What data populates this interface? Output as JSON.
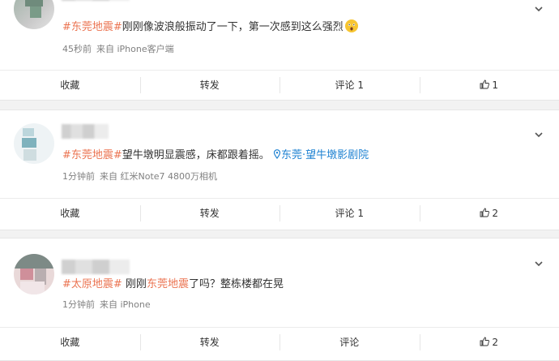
{
  "posts": [
    {
      "text_pre": "",
      "tag1": "#东莞地震#",
      "text_mid": "刚刚像波浪般振动了一下，第一次感到这么强烈",
      "tag2": "",
      "text_post": "",
      "location": "",
      "time": "45秒前",
      "source": "来自 iPhone客户端",
      "actions": {
        "favorite": "收藏",
        "repost": "转发",
        "comment": "评论 1",
        "like": "1"
      }
    },
    {
      "tag1": "#东莞地震#",
      "text_mid": "望牛墩明显震感，床都跟着摇。",
      "location_icon": "location-pin",
      "location": "东莞·望牛墩影剧院",
      "time": "1分钟前",
      "source": "来自 红米Note7 4800万相机",
      "actions": {
        "favorite": "收藏",
        "repost": "转发",
        "comment": "评论 1",
        "like": "2"
      }
    },
    {
      "tag1": "#太原地震#",
      "text_mid": " 刚刚",
      "tag2": "东莞地震",
      "text_post": "了吗？整栋楼都在晃",
      "time": "1分钟前",
      "source": "来自 iPhone",
      "actions": {
        "favorite": "收藏",
        "repost": "转发",
        "comment": "评论",
        "like": "2"
      }
    }
  ],
  "colors": {
    "tag": "#eb7350",
    "link": "#1e82d2",
    "meta": "#808080"
  }
}
